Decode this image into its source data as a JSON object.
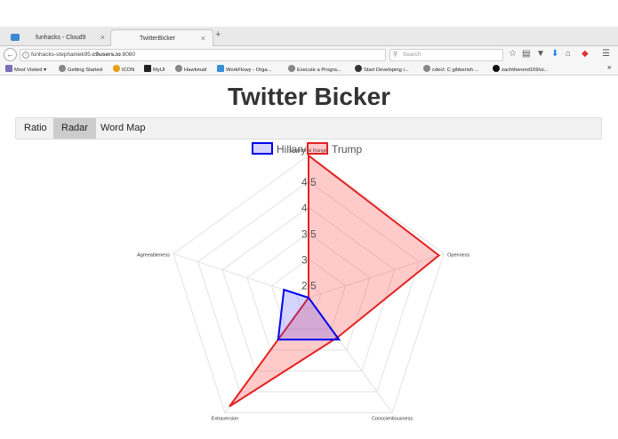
{
  "browser": {
    "tabs": [
      {
        "label": "funhacks - Cloud9",
        "close": "×"
      },
      {
        "label": "TwitterBicker",
        "close": "×"
      }
    ],
    "new_tab": "+",
    "url_host": "funhacks-stephaniek95.",
    "url_bold": "c9users.io",
    "url_port": ":8080",
    "search_placeholder": "Search",
    "bookmarks": [
      "Most Visited ▾",
      "Getting Started",
      "ICON",
      "MyUI",
      "Hawkmail",
      "WorkFlowy - Orga...",
      "Execute a Progra...",
      "Start Developing i...",
      "cdecl: C gibberish ...",
      "zachthenerd169/ui..."
    ],
    "overflow": "»"
  },
  "page": {
    "title": "Twitter Bicker",
    "tabs": [
      {
        "label": "Ratio"
      },
      {
        "label": "Radar"
      },
      {
        "label": "Word Map"
      }
    ]
  },
  "chart_data": {
    "type": "radar",
    "categories": [
      "Emotional Range",
      "Openness",
      "Conscientiousness",
      "Extraversion",
      "Agreeableness"
    ],
    "series": [
      {
        "name": "Hillary",
        "values": [
          2.25,
          2.25,
          3.25,
          3.25,
          2.75
        ],
        "stroke": "#0000ee",
        "fill": "rgba(60,60,255,0.22)"
      },
      {
        "name": "Trump",
        "values": [
          5.0,
          4.9,
          3.2,
          4.85,
          2.25
        ],
        "stroke": "#e32222",
        "fill": "rgba(255,80,80,0.3)"
      }
    ],
    "ticks": [
      "2.5",
      "3",
      "3.5",
      "4",
      "4.5"
    ],
    "tick_values": [
      2.5,
      3,
      3.5,
      4,
      4.5
    ],
    "scale_min": 2.25,
    "scale_max": 5.0,
    "legend": "top-center"
  }
}
